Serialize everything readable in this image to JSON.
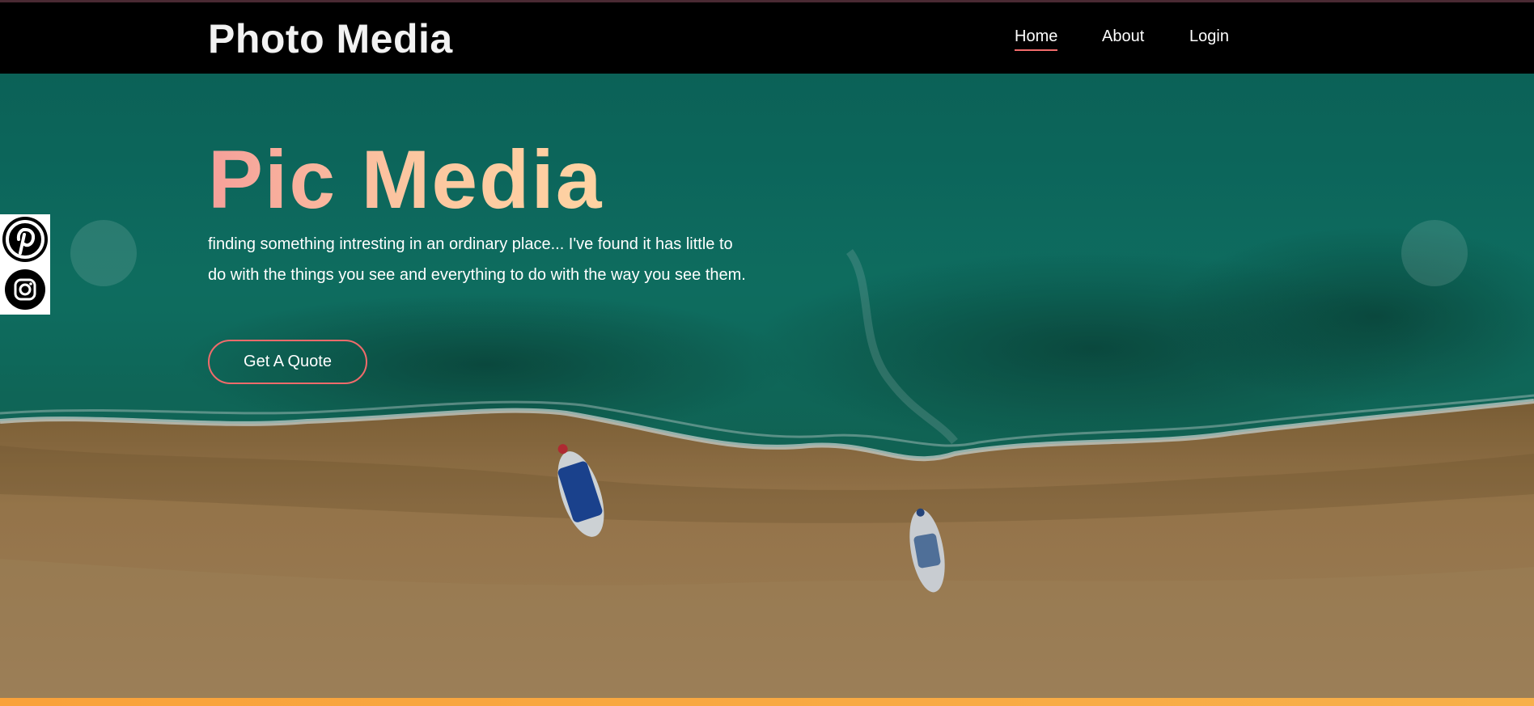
{
  "header": {
    "brand": "Photo Media",
    "nav": [
      {
        "label": "Home",
        "active": true
      },
      {
        "label": "About",
        "active": false
      },
      {
        "label": "Login",
        "active": false
      }
    ]
  },
  "hero": {
    "title": "Pic Media",
    "text_line1": "finding something intresting in an ordinary place... I've found it has little to",
    "text_line2": "do with the things you see and everything to do with the way you see them.",
    "cta_label": "Get A Quote",
    "background": "aerial-beach-with-boats"
  },
  "social": [
    {
      "name": "pinterest-icon"
    },
    {
      "name": "instagram-icon"
    }
  ],
  "colors": {
    "accent": "#f06b6b",
    "title_gradient_start": "#f5a09a",
    "title_gradient_end": "#ffd3a2",
    "navbar_bg": "#000000",
    "bottom_bar": "#f9a23a"
  }
}
